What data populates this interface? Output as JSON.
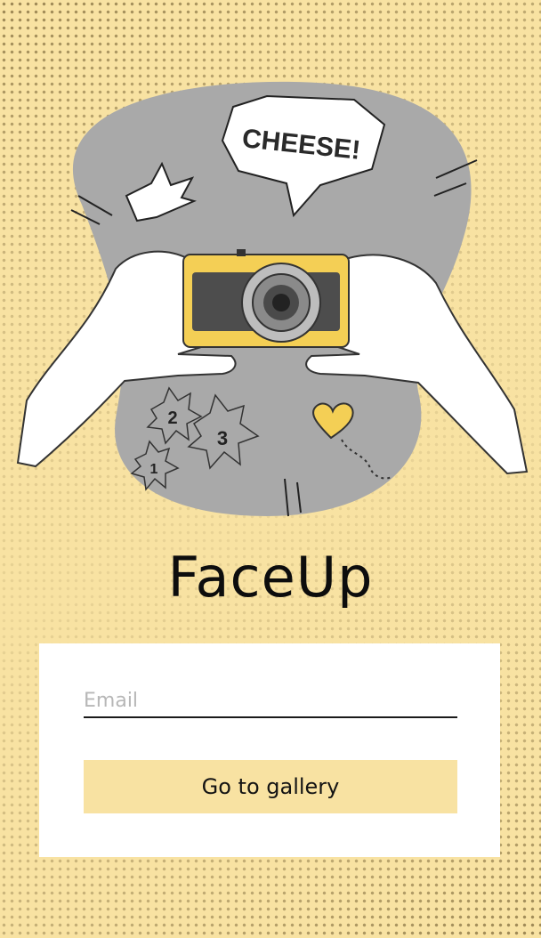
{
  "app": {
    "title": "FaceUp"
  },
  "illustration": {
    "speech_text": "CHEESE!",
    "burst_labels": [
      "2",
      "3",
      "1"
    ]
  },
  "form": {
    "email_placeholder": "Email",
    "email_value": "",
    "submit_label": "Go to gallery"
  },
  "colors": {
    "background": "#f8e2a2",
    "accent": "#f4cf55",
    "blob": "#a9a9a9",
    "card": "#ffffff",
    "text": "#0d0d0d"
  }
}
